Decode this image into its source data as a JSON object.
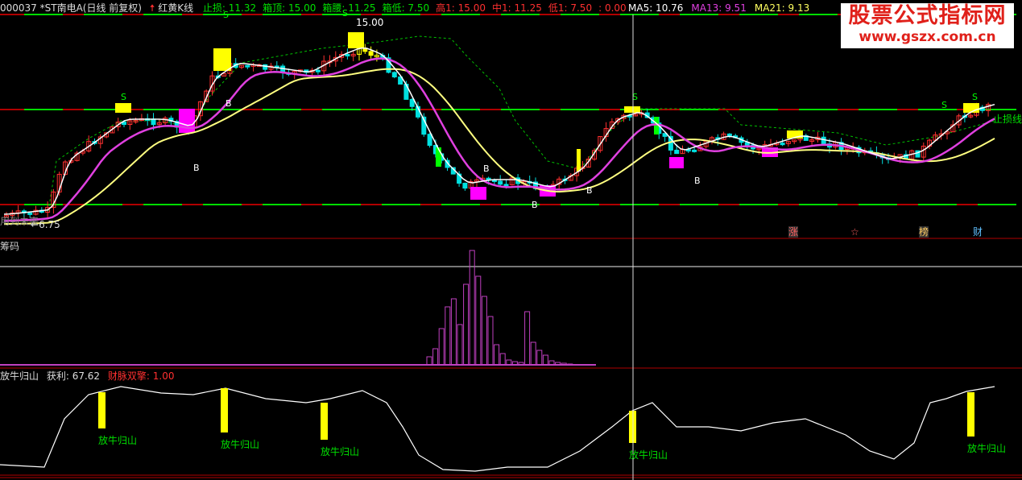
{
  "header": {
    "symbol": "000037 *ST南电A(日线 前复权)",
    "indicator_name": "红黄K线",
    "items": [
      {
        "label": "止损: ",
        "value": "11.32",
        "color": "#00e000"
      },
      {
        "label": "箱顶: ",
        "value": "15.00",
        "color": "#00e000"
      },
      {
        "label": "箱腰: ",
        "value": "11.25",
        "color": "#00e000"
      },
      {
        "label": "箱低: ",
        "value": "7.50",
        "color": "#00e000"
      },
      {
        "label": "高1: ",
        "value": "15.00",
        "color": "#ff3030"
      },
      {
        "label": "中1: ",
        "value": "11.25",
        "color": "#ff3030"
      },
      {
        "label": "低1: ",
        "value": "7.50",
        "color": "#ff3030"
      },
      {
        "label": ": ",
        "value": "0.00",
        "color": "#ff3030"
      }
    ],
    "ma": [
      {
        "label": "MA5: ",
        "value": "10.76",
        "color": "#ffffff"
      },
      {
        "label": "MA13: ",
        "value": "9.51",
        "color": "#e040e0"
      },
      {
        "label": "MA21: ",
        "value": "9.13",
        "color": "#ffff60"
      }
    ]
  },
  "watermark": {
    "line1": "股票公式指标网",
    "line2": "www.gszx.com.cn"
  },
  "main_chart": {
    "peak_label": "15.00",
    "low_label": "6.75",
    "left_text": "用到未来",
    "stoploss_label": "止损线",
    "marker_s": "S",
    "marker_b": "B",
    "events": [
      "涨",
      "☆",
      "榜",
      "财"
    ]
  },
  "chip_panel": {
    "title": "筹码"
  },
  "bottom_panel": {
    "title": "放牛归山",
    "profit_label": "获利: ",
    "profit_value": "67.62",
    "sub_label": "财脉双擎: ",
    "sub_value": "1.00",
    "signal_label": "放牛归山"
  },
  "colors": {
    "up": "#ff3030",
    "down": "#00e0e0",
    "yellow": "#ffff00",
    "magenta": "#ff00ff",
    "green": "#00ff00",
    "ma5": "#ffffff",
    "ma13": "#e040e0",
    "ma21": "#ffff80",
    "grid_red": "#b00000",
    "stop": "#00e000"
  }
}
